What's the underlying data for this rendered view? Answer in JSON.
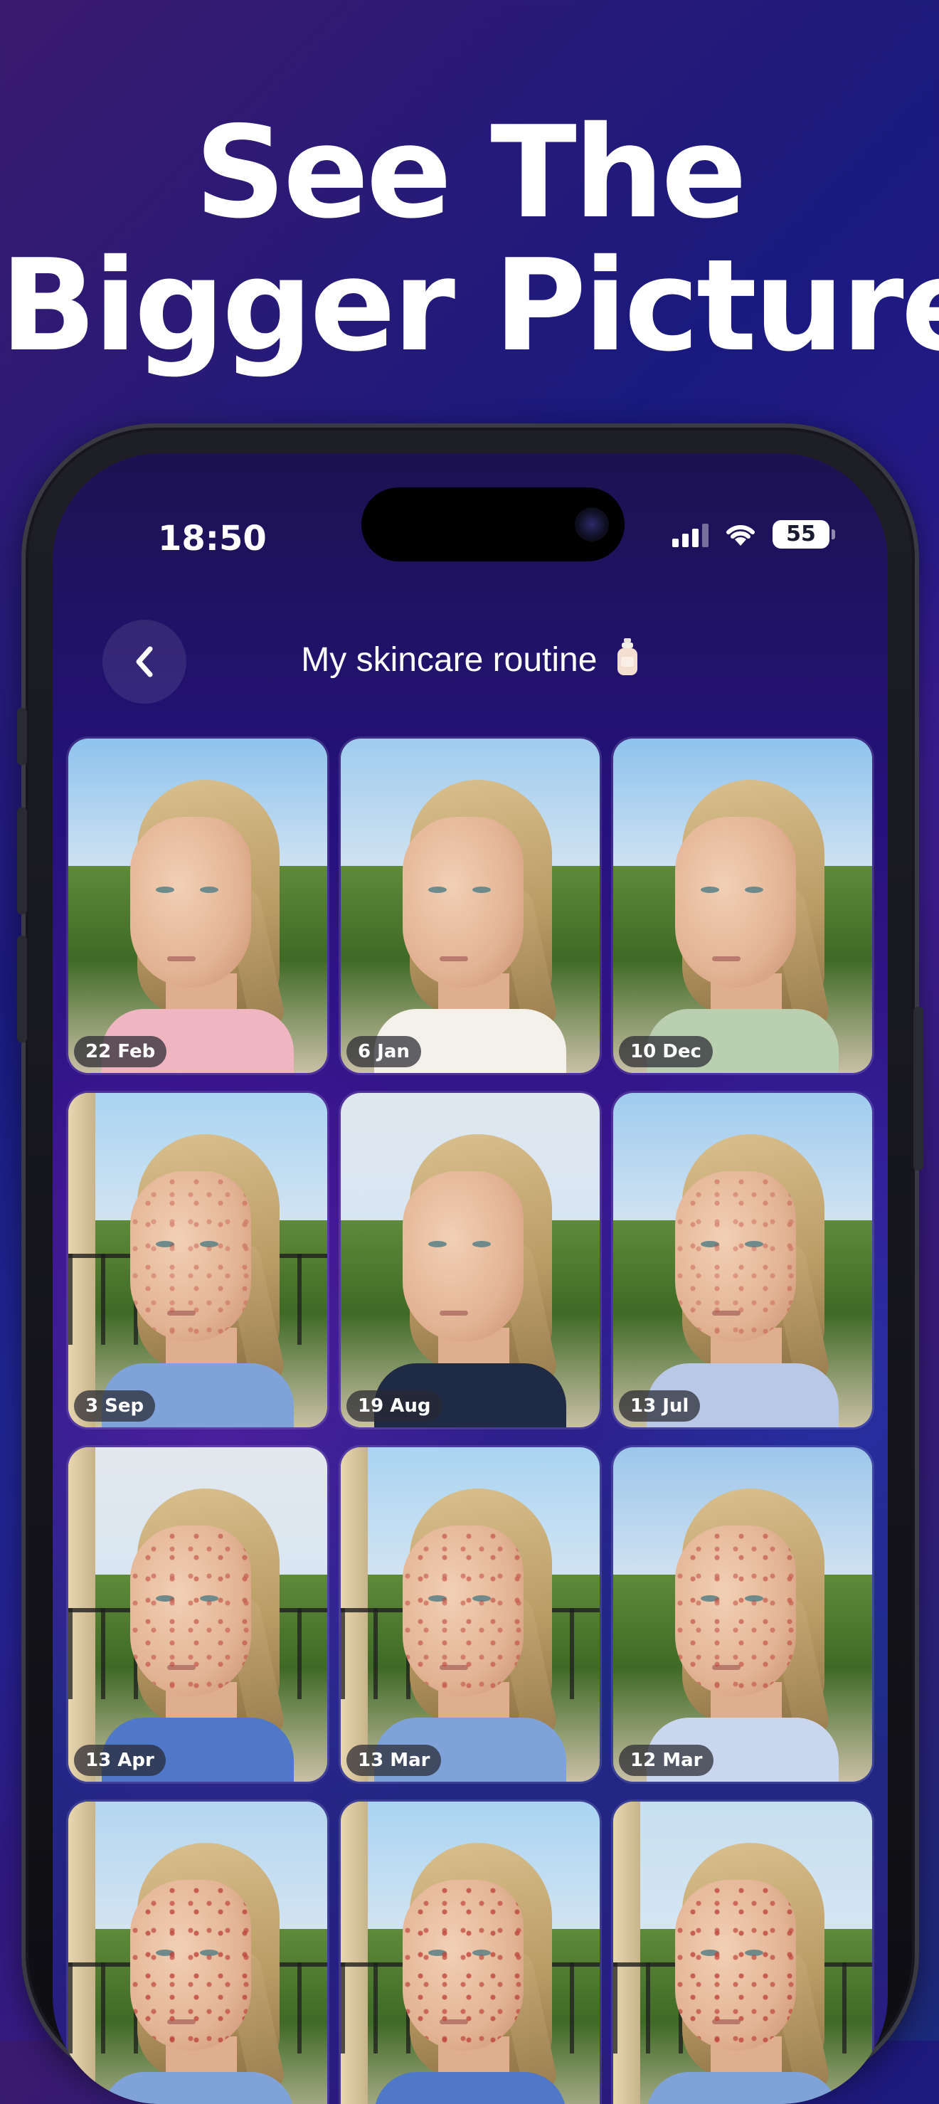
{
  "headline": {
    "line1": "See The",
    "line2": "Bigger Picture"
  },
  "status_bar": {
    "time": "18:50",
    "battery": "55"
  },
  "nav": {
    "back_icon": "chevron-left-icon",
    "title": "My skincare routine",
    "title_icon": "lotion-bottle-icon"
  },
  "photos": [
    {
      "date": "22 Feb"
    },
    {
      "date": "6 Jan"
    },
    {
      "date": "10 Dec"
    },
    {
      "date": "3 Sep"
    },
    {
      "date": "19 Aug"
    },
    {
      "date": "13 Jul"
    },
    {
      "date": "13 Apr"
    },
    {
      "date": "13 Mar"
    },
    {
      "date": "12 Mar"
    },
    {
      "date": ""
    },
    {
      "date": ""
    },
    {
      "date": ""
    }
  ],
  "colors": {
    "background_top": "#1a1a7e",
    "background_accent": "#3a1690",
    "text": "#ffffff",
    "badge_bg": "#28283280"
  }
}
